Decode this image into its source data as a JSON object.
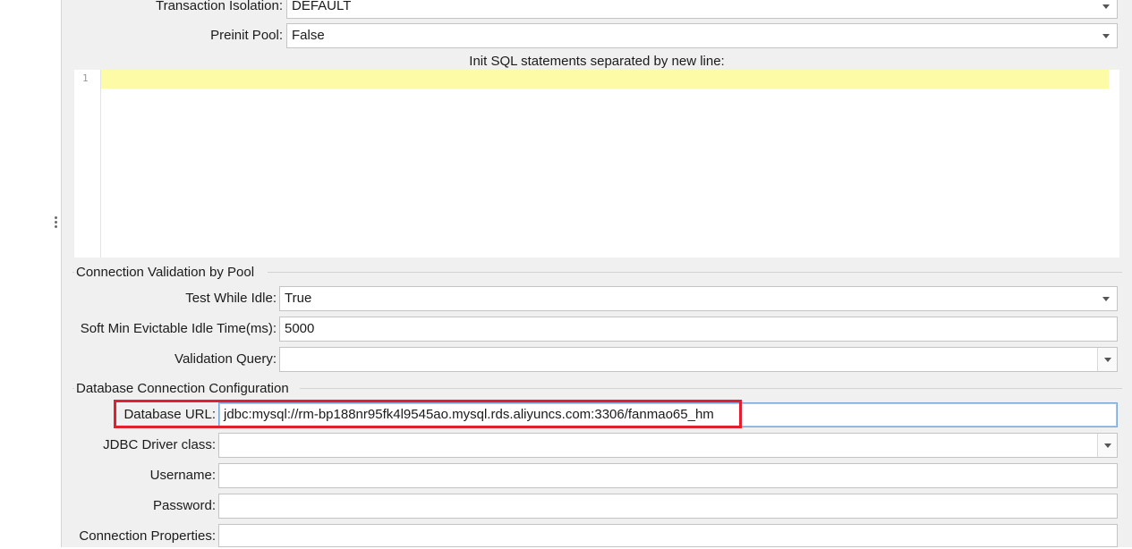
{
  "transaction_isolation": {
    "label": "Transaction Isolation:",
    "value": "DEFAULT"
  },
  "preinit_pool": {
    "label": "Preinit Pool:",
    "value": "False"
  },
  "init_sql": {
    "title": "Init SQL statements separated by new line:",
    "line_number": "1",
    "content": ""
  },
  "validation_section": {
    "title": "Connection Validation by Pool",
    "test_while_idle": {
      "label": "Test While Idle:",
      "value": "True"
    },
    "soft_min_evictable": {
      "label": "Soft Min Evictable Idle Time(ms):",
      "value": "5000"
    },
    "validation_query": {
      "label": "Validation Query:",
      "value": ""
    }
  },
  "db_section": {
    "title": "Database Connection Configuration",
    "database_url": {
      "label": "Database URL:",
      "value": "jdbc:mysql://rm-bp188nr95fk4l9545ao.mysql.rds.aliyuncs.com:3306/fanmao65_hm"
    },
    "jdbc_driver": {
      "label": "JDBC Driver class:",
      "value": ""
    },
    "username": {
      "label": "Username:",
      "value": ""
    },
    "password": {
      "label": "Password:",
      "value": ""
    },
    "connection_properties": {
      "label": "Connection Properties:",
      "value": ""
    }
  },
  "colors": {
    "highlight": "#e0202e",
    "current_line": "#fefba7",
    "panel": "#f0f0f0"
  }
}
